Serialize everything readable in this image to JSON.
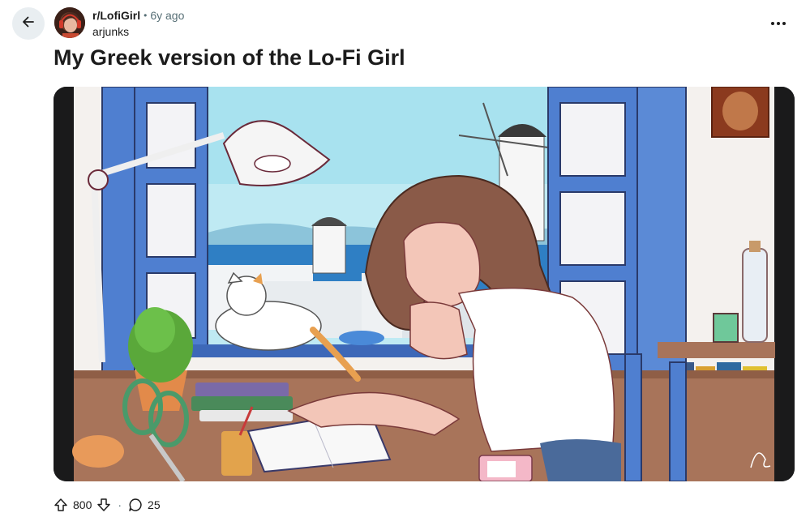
{
  "post": {
    "subreddit": "r/LofiGirl",
    "separator": "•",
    "age": "6y ago",
    "author": "arjunks",
    "title": "My Greek version of the Lo-Fi Girl"
  },
  "actions": {
    "upvotes": "800",
    "comments": "25",
    "dot": "·"
  },
  "icons": {
    "back": "arrow-left-icon",
    "more": "more-horizontal-icon",
    "upvote": "arrow-up-outline-icon",
    "downvote": "arrow-down-outline-icon",
    "comment": "speech-bubble-icon"
  },
  "colors": {
    "window_blue": "#4f7fd0",
    "sky": "#c8eef5",
    "sea": "#3a86c8",
    "desk": "#a8745a",
    "text_muted": "#576f76"
  }
}
